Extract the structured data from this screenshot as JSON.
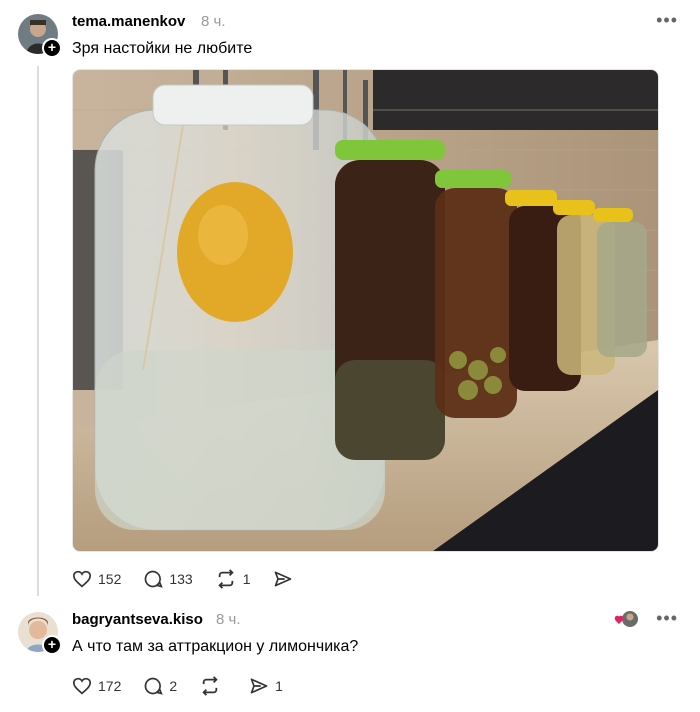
{
  "posts": [
    {
      "username": "tema.manenkov",
      "time": "8 ч.",
      "text": "Зря настойки не любите",
      "likes": "152",
      "comments": "133",
      "reposts": "1",
      "shares": ""
    },
    {
      "username": "bagryantseva.kiso",
      "time": "8 ч.",
      "text": "А что там за аттракцион у лимончика?",
      "likes": "172",
      "comments": "2",
      "reposts": "",
      "shares": "1"
    }
  ],
  "icons": {
    "more": "more-icon",
    "like": "heart-icon",
    "comment": "comment-icon",
    "repost": "repost-icon",
    "share": "send-icon",
    "follow": "plus-icon"
  },
  "colors": {
    "muted": "#999999",
    "like_badge": "#e0245e"
  }
}
